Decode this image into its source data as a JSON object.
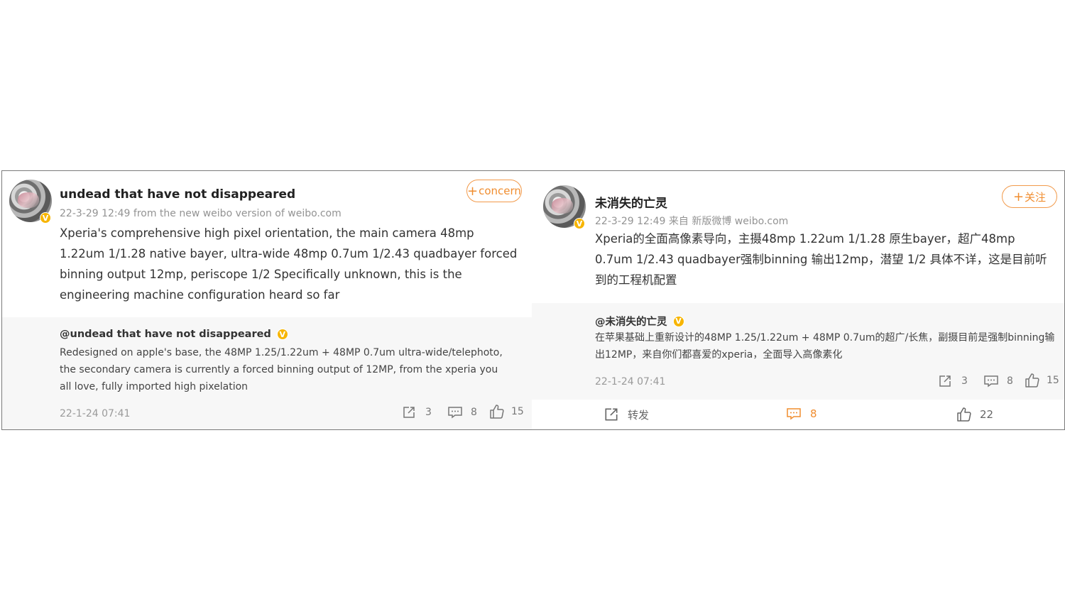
{
  "left": {
    "author": "undead that have not disappeared",
    "meta": "22-3-29 12:49  from the new weibo version of weibo.com",
    "follow_label": "concern",
    "content": "Xperia's comprehensive high pixel orientation, the main camera 48mp 1.22um 1/1.28 native bayer, ultra-wide 48mp 0.7um 1/2.43 quadbayer forced binning output 12mp, periscope 1/2 Specifically unknown, this is the engineering machine configuration heard so far",
    "quote": {
      "author": "@undead that have not disappeared",
      "text": "Redesigned on apple's base, the 48MP 1.25/1.22um + 48MP 0.7um ultra-wide/telephoto, the secondary camera is currently a forced binning output of 12MP, from the xperia you all love, fully imported high pixelation",
      "time": "22-1-24 07:41",
      "reposts": "3",
      "comments": "8",
      "likes": "15"
    }
  },
  "right": {
    "author": "未消失的亡灵",
    "meta": "22-3-29 12:49  来自 新版微博 weibo.com",
    "follow_label": "关注",
    "content": "Xperia的全面高像素导向，主摄48mp 1.22um 1/1.28 原生bayer，超广48mp 0.7um 1/2.43 quadbayer强制binning 输出12mp，潜望 1/2 具体不详，这是目前听到的工程机配置",
    "quote": {
      "author": "@未消失的亡灵",
      "text": "在苹果基础上重新设计的48MP 1.25/1.22um + 48MP 0.7um的超广/长焦，副摄目前是强制binning输出12MP，来自你们都喜爱的xperia，全面导入高像素化",
      "time": "22-1-24 07:41",
      "reposts": "3",
      "comments": "8",
      "likes": "15"
    },
    "actions": {
      "repost_label": "转发",
      "comment_count": "8",
      "like_count": "22"
    }
  },
  "verified_mark": "V",
  "colors": {
    "accent": "#f08d2f",
    "verified": "#f7b500",
    "quote_bg": "#f7f7f7",
    "muted": "#939393"
  },
  "icons": [
    "avatar",
    "verified-icon",
    "plus-icon",
    "repost-icon",
    "comment-icon",
    "like-icon"
  ]
}
